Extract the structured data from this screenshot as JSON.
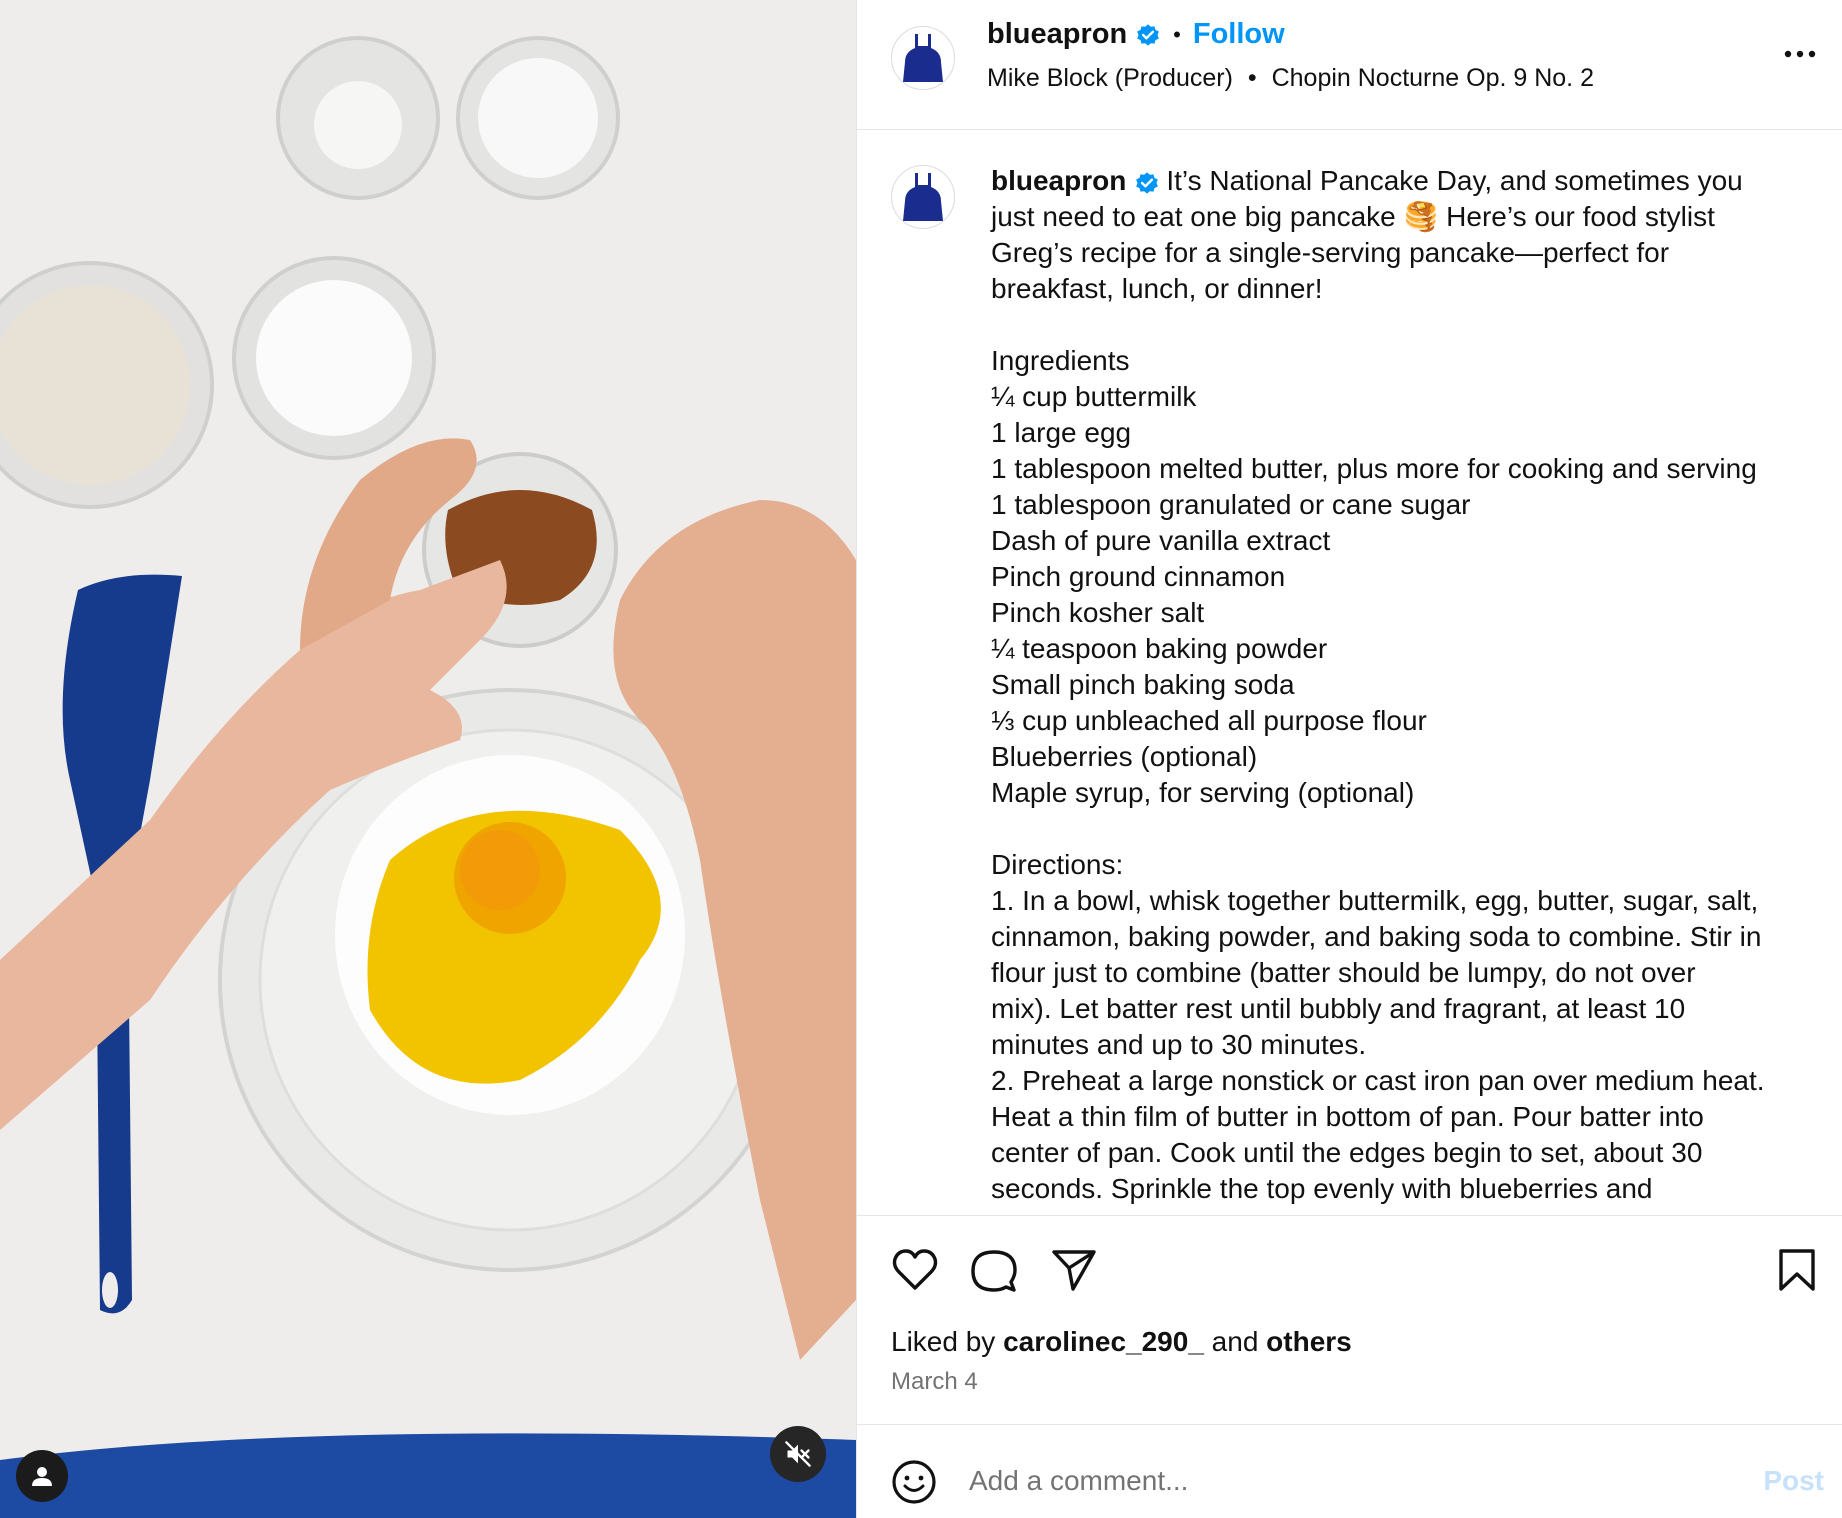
{
  "header": {
    "username": "blueapron",
    "separator": "•",
    "follow_label": "Follow",
    "producer": "Mike Block (Producer)",
    "audio_separator": "•",
    "audio": "Chopin Nocturne Op. 9 No. 2"
  },
  "caption": {
    "username": "blueapron",
    "lines": [
      "It’s National Pancake Day, and sometimes you",
      "just need to eat one big pancake 🥞 Here’s our food stylist",
      "Greg’s recipe for a single-serving pancake—perfect for",
      "breakfast, lunch, or dinner!",
      "",
      "Ingredients",
      "¼ cup buttermilk",
      "1 large egg",
      "1 tablespoon melted butter, plus more for cooking and serving",
      "1 tablespoon granulated or cane sugar",
      "Dash of pure vanilla extract",
      "Pinch ground cinnamon",
      "Pinch kosher salt",
      "¼ teaspoon baking powder",
      "Small pinch baking soda",
      "⅓ cup unbleached all purpose flour",
      "Blueberries (optional)",
      "Maple syrup, for serving (optional)",
      "",
      "Directions:",
      "1. In a bowl, whisk together buttermilk, egg, butter, sugar, salt,",
      "cinnamon, baking powder, and baking soda to combine. Stir in",
      "flour just to combine (batter should be lumpy, do not over",
      "mix). Let batter rest until bubbly and fragrant, at least 10",
      "minutes and up to 30 minutes.",
      "2. Preheat a large nonstick or cast iron pan over medium heat.",
      "Heat a thin film of butter in bottom of pan. Pour batter into",
      "center of pan. Cook until the edges begin to set, about 30",
      "seconds. Sprinkle the top evenly with blueberries and"
    ]
  },
  "likes": {
    "prefix": "Liked by",
    "user": "carolinec_290_",
    "conjunction": "and",
    "others": "others"
  },
  "date": "March 4",
  "comment": {
    "placeholder": "Add a comment...",
    "post_label": "Post"
  },
  "colors": {
    "accent": "#0095f6",
    "brand_blue": "#1a2d8f",
    "post_disabled": "#c7e1fb"
  }
}
